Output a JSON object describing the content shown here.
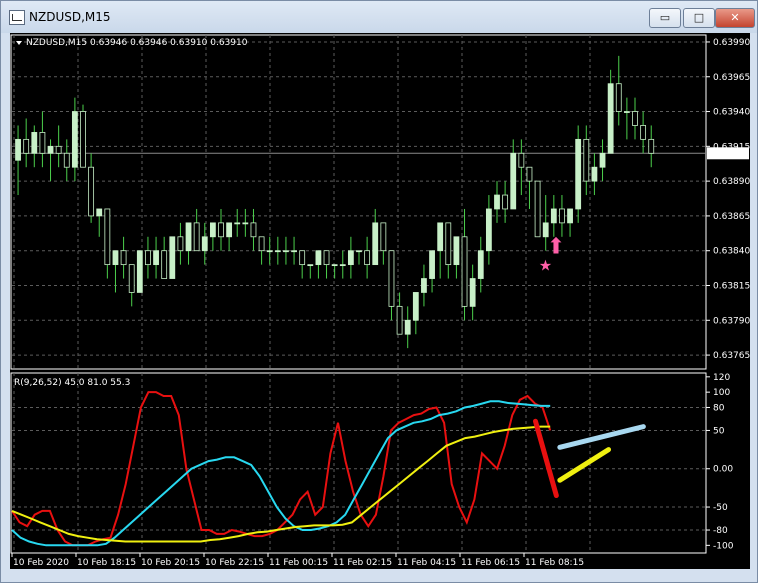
{
  "window": {
    "title": "NZDUSD,M15",
    "minimize_glyph": "▭",
    "maximize_glyph": "□",
    "close_glyph": "✕"
  },
  "colors": {
    "background": "#000000",
    "grid": "#5c5c5c",
    "candle": "#c8f0c8",
    "wick": "#4cd04c",
    "red_line": "#e81010",
    "cyan_line": "#28d8f0",
    "yellow_line": "#f0f010",
    "arrow": "#ff5fa8"
  },
  "chart_data": [
    {
      "type": "candlestick",
      "title": "NZDUSD,M15  0.63946 0.63946 0.63910 0.63910",
      "current_price_label": "0.63910",
      "y_ticks": [
        "0.63990",
        "0.63965",
        "0.63940",
        "0.63915",
        "0.63890",
        "0.63865",
        "0.63840",
        "0.63815",
        "0.63790",
        "0.63765"
      ],
      "ylim": [
        0.63755,
        0.63995
      ],
      "current_price": 0.6391,
      "candles_ohlc": [
        [
          0.63905,
          0.6393,
          0.6388,
          0.6392
        ],
        [
          0.6392,
          0.63935,
          0.639,
          0.6391
        ],
        [
          0.6391,
          0.6393,
          0.639,
          0.63925
        ],
        [
          0.63925,
          0.6394,
          0.639,
          0.6391
        ],
        [
          0.6391,
          0.6392,
          0.6389,
          0.63915
        ],
        [
          0.63915,
          0.6393,
          0.639,
          0.6391
        ],
        [
          0.6391,
          0.6392,
          0.6389,
          0.639
        ],
        [
          0.639,
          0.6395,
          0.6389,
          0.6394
        ],
        [
          0.6394,
          0.63945,
          0.639,
          0.639
        ],
        [
          0.639,
          0.6391,
          0.6386,
          0.63865
        ],
        [
          0.63865,
          0.6387,
          0.6385,
          0.6387
        ],
        [
          0.6387,
          0.6387,
          0.6382,
          0.6383
        ],
        [
          0.6383,
          0.6384,
          0.6381,
          0.6384
        ],
        [
          0.6384,
          0.6385,
          0.6382,
          0.6383
        ],
        [
          0.6383,
          0.6383,
          0.638,
          0.6381
        ],
        [
          0.6381,
          0.6384,
          0.6381,
          0.6384
        ],
        [
          0.6384,
          0.6385,
          0.6382,
          0.6383
        ],
        [
          0.6383,
          0.6385,
          0.6382,
          0.6384
        ],
        [
          0.6384,
          0.6385,
          0.6382,
          0.6382
        ],
        [
          0.6382,
          0.6385,
          0.6382,
          0.6385
        ],
        [
          0.6385,
          0.6386,
          0.6383,
          0.6384
        ],
        [
          0.6384,
          0.6386,
          0.6383,
          0.6386
        ],
        [
          0.6386,
          0.6387,
          0.6384,
          0.6384
        ],
        [
          0.6384,
          0.6386,
          0.6383,
          0.6385
        ],
        [
          0.6385,
          0.6386,
          0.6384,
          0.6386
        ],
        [
          0.6386,
          0.6387,
          0.6384,
          0.6385
        ],
        [
          0.6385,
          0.6386,
          0.6384,
          0.6386
        ],
        [
          0.6386,
          0.6387,
          0.6385,
          0.6386
        ],
        [
          0.6386,
          0.6387,
          0.6385,
          0.6386
        ],
        [
          0.6386,
          0.6387,
          0.6384,
          0.6385
        ],
        [
          0.6385,
          0.6385,
          0.6383,
          0.6384
        ],
        [
          0.6384,
          0.6385,
          0.6383,
          0.6384
        ],
        [
          0.6384,
          0.6385,
          0.6383,
          0.6384
        ],
        [
          0.6384,
          0.6385,
          0.6383,
          0.6384
        ],
        [
          0.6384,
          0.6385,
          0.6383,
          0.6384
        ],
        [
          0.6384,
          0.6384,
          0.6382,
          0.6383
        ],
        [
          0.6383,
          0.6383,
          0.6382,
          0.6383
        ],
        [
          0.6383,
          0.6384,
          0.6382,
          0.6384
        ],
        [
          0.6384,
          0.6384,
          0.6382,
          0.6383
        ],
        [
          0.6383,
          0.6383,
          0.6382,
          0.6383
        ],
        [
          0.6383,
          0.6384,
          0.6382,
          0.6383
        ],
        [
          0.6383,
          0.6385,
          0.6382,
          0.6384
        ],
        [
          0.6384,
          0.6384,
          0.6383,
          0.6384
        ],
        [
          0.6384,
          0.6385,
          0.6382,
          0.6383
        ],
        [
          0.6383,
          0.6387,
          0.6383,
          0.6386
        ],
        [
          0.6386,
          0.6386,
          0.6383,
          0.6384
        ],
        [
          0.6384,
          0.6384,
          0.6379,
          0.638
        ],
        [
          0.638,
          0.6381,
          0.6378,
          0.6378
        ],
        [
          0.6378,
          0.638,
          0.6377,
          0.6379
        ],
        [
          0.6379,
          0.6381,
          0.6378,
          0.6381
        ],
        [
          0.6381,
          0.6383,
          0.638,
          0.6382
        ],
        [
          0.6382,
          0.6384,
          0.6381,
          0.6384
        ],
        [
          0.6384,
          0.6386,
          0.6382,
          0.6386
        ],
        [
          0.6386,
          0.6386,
          0.6382,
          0.6383
        ],
        [
          0.6383,
          0.6385,
          0.6382,
          0.6385
        ],
        [
          0.6385,
          0.6387,
          0.6379,
          0.638
        ],
        [
          0.638,
          0.6383,
          0.6379,
          0.6382
        ],
        [
          0.6382,
          0.6385,
          0.6381,
          0.6384
        ],
        [
          0.6384,
          0.6388,
          0.6383,
          0.6387
        ],
        [
          0.6387,
          0.6389,
          0.6386,
          0.6388
        ],
        [
          0.6388,
          0.6389,
          0.6386,
          0.6387
        ],
        [
          0.6387,
          0.6392,
          0.6387,
          0.6391
        ],
        [
          0.6391,
          0.6392,
          0.6388,
          0.639
        ],
        [
          0.639,
          0.639,
          0.6387,
          0.6389
        ],
        [
          0.6389,
          0.6389,
          0.6385,
          0.6385
        ],
        [
          0.6385,
          0.6388,
          0.6384,
          0.6386
        ],
        [
          0.6386,
          0.6388,
          0.6385,
          0.6387
        ],
        [
          0.6387,
          0.6388,
          0.6385,
          0.6386
        ],
        [
          0.6386,
          0.6387,
          0.6385,
          0.6387
        ],
        [
          0.6387,
          0.6393,
          0.6386,
          0.6392
        ],
        [
          0.6392,
          0.6393,
          0.6388,
          0.6389
        ],
        [
          0.6389,
          0.6391,
          0.6388,
          0.639
        ],
        [
          0.639,
          0.6392,
          0.6389,
          0.6391
        ],
        [
          0.6391,
          0.6397,
          0.6391,
          0.6396
        ],
        [
          0.6396,
          0.6398,
          0.6393,
          0.6394
        ],
        [
          0.6394,
          0.6395,
          0.6392,
          0.6394
        ],
        [
          0.6394,
          0.6395,
          0.6392,
          0.6393
        ],
        [
          0.6393,
          0.6394,
          0.6391,
          0.6392
        ],
        [
          0.6392,
          0.6393,
          0.639,
          0.6391
        ]
      ],
      "markers": [
        {
          "type": "arrow-up",
          "index": 66,
          "price": 0.63838,
          "label": "⬆"
        },
        {
          "type": "star",
          "index": 65,
          "price": 0.6383,
          "label": "★"
        }
      ]
    },
    {
      "type": "line",
      "title": "R(9,26,52) 45.0 81.0 55.3",
      "y_ticks": [
        "120",
        "100",
        "80",
        "50",
        "0.00",
        "-50",
        "-80",
        "-100"
      ],
      "ylim": [
        -110,
        125
      ],
      "x_labels": [
        "10 Feb 2020",
        "10 Feb 18:15",
        "10 Feb 20:15",
        "10 Feb 22:15",
        "11 Feb 00:15",
        "11 Feb 02:15",
        "11 Feb 04:15",
        "11 Feb 06:15",
        "11 Feb 08:15"
      ],
      "series": [
        {
          "color": "red_line",
          "values": [
            -55,
            -70,
            -75,
            -60,
            -55,
            -55,
            -80,
            -95,
            -100,
            -100,
            -100,
            -95,
            -92,
            -90,
            -60,
            -20,
            30,
            80,
            100,
            100,
            95,
            95,
            70,
            0,
            -40,
            -80,
            -80,
            -85,
            -85,
            -80,
            -82,
            -85,
            -88,
            -88,
            -85,
            -80,
            -70,
            -60,
            -40,
            -30,
            -60,
            -50,
            20,
            60,
            10,
            -30,
            -60,
            -75,
            -60,
            -10,
            50,
            60,
            65,
            70,
            72,
            78,
            80,
            60,
            -20,
            -50,
            -70,
            -40,
            20,
            10,
            0,
            30,
            70,
            90,
            95,
            85,
            80,
            50
          ]
        },
        {
          "color": "cyan_line",
          "values": [
            -80,
            -90,
            -95,
            -98,
            -100,
            -100,
            -100,
            -100,
            -100,
            -100,
            -100,
            -98,
            -90,
            -80,
            -70,
            -60,
            -50,
            -40,
            -30,
            -20,
            -10,
            0,
            5,
            10,
            12,
            15,
            15,
            10,
            5,
            -10,
            -30,
            -50,
            -65,
            -75,
            -80,
            -80,
            -78,
            -75,
            -70,
            -60,
            -40,
            -20,
            0,
            20,
            40,
            50,
            55,
            60,
            62,
            65,
            70,
            72,
            75,
            80,
            82,
            85,
            88,
            88,
            86,
            85,
            84,
            83,
            82,
            82
          ]
        },
        {
          "color": "yellow_line",
          "values": [
            -55,
            -60,
            -65,
            -70,
            -75,
            -80,
            -85,
            -88,
            -90,
            -92,
            -93,
            -94,
            -95,
            -95,
            -95,
            -95,
            -95,
            -95,
            -95,
            -95,
            -95,
            -93,
            -92,
            -90,
            -88,
            -85,
            -83,
            -82,
            -80,
            -78,
            -76,
            -75,
            -74,
            -74,
            -74,
            -73,
            -70,
            -60,
            -50,
            -40,
            -30,
            -20,
            -10,
            0,
            10,
            20,
            30,
            35,
            40,
            42,
            45,
            48,
            50,
            52,
            53,
            54,
            55,
            55
          ]
        }
      ],
      "annotations": [
        {
          "color": "#a8d8f0",
          "from": [
            0.79,
            28
          ],
          "to": [
            0.91,
            55
          ]
        },
        {
          "color": "#e81010",
          "from": [
            0.755,
            62
          ],
          "to": [
            0.785,
            -35
          ]
        },
        {
          "color": "#f0f010",
          "from": [
            0.79,
            -15
          ],
          "to": [
            0.86,
            25
          ]
        }
      ]
    }
  ]
}
